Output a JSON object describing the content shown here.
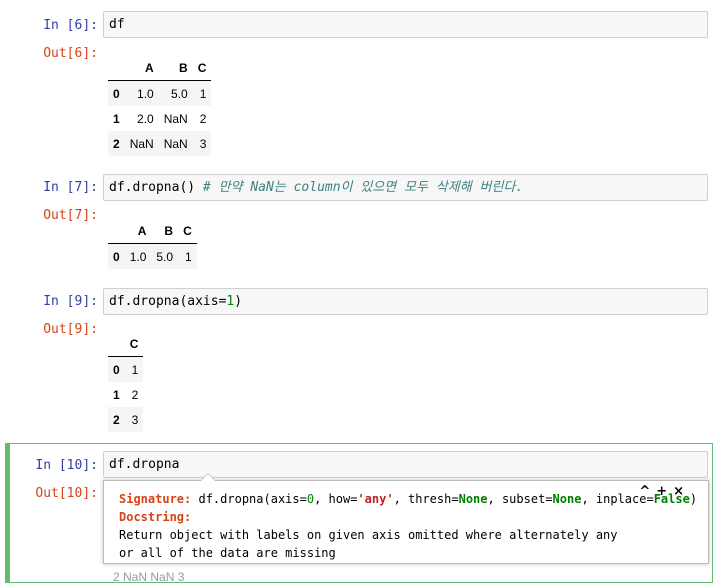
{
  "cells": [
    {
      "in_prompt": "In [6]:",
      "code": "df",
      "out_prompt": "Out[6]:",
      "table": {
        "columns": [
          "A",
          "B",
          "C"
        ],
        "rows": [
          {
            "index": "0",
            "values": [
              "1.0",
              "5.0",
              "1"
            ]
          },
          {
            "index": "1",
            "values": [
              "2.0",
              "NaN",
              "2"
            ]
          },
          {
            "index": "2",
            "values": [
              "NaN",
              "NaN",
              "3"
            ]
          }
        ]
      }
    },
    {
      "in_prompt": "In [7]:",
      "code": "df.dropna()",
      "comment": "# 만약 NaN는 column이 있으면 모두 삭제해 버린다.",
      "out_prompt": "Out[7]:",
      "table": {
        "columns": [
          "A",
          "B",
          "C"
        ],
        "rows": [
          {
            "index": "0",
            "values": [
              "1.0",
              "5.0",
              "1"
            ]
          }
        ]
      }
    },
    {
      "in_prompt": "In [9]:",
      "code_prefix": "df.dropna(axis=",
      "code_num": "1",
      "code_suffix": ")",
      "out_prompt": "Out[9]:",
      "table": {
        "columns": [
          "C"
        ],
        "rows": [
          {
            "index": "0",
            "values": [
              "1"
            ]
          },
          {
            "index": "1",
            "values": [
              "2"
            ]
          },
          {
            "index": "2",
            "values": [
              "3"
            ]
          }
        ]
      }
    },
    {
      "in_prompt": "In [10]:",
      "code": "df.dropna",
      "out_prompt": "Out[10]:"
    }
  ],
  "tooltip": {
    "signature_label": "Signature:",
    "signature_pre": " df.dropna(axis=",
    "sig_axis": "0",
    "sig_how_pre": ", how=",
    "sig_how": "'any'",
    "sig_thresh_pre": ", thresh=",
    "sig_thresh": "None",
    "sig_subset_pre": ", subset=",
    "sig_subset": "None",
    "sig_inplace_pre": ", inplace=",
    "sig_inplace": "False",
    "sig_close": ")",
    "docstring_label": "Docstring:",
    "doc_line1": "Return object with labels on given axis omitted where alternately any",
    "doc_line2": "or all of the data are missing",
    "controls": "^+×"
  },
  "peek_text": "2  NaN  NaN  3"
}
